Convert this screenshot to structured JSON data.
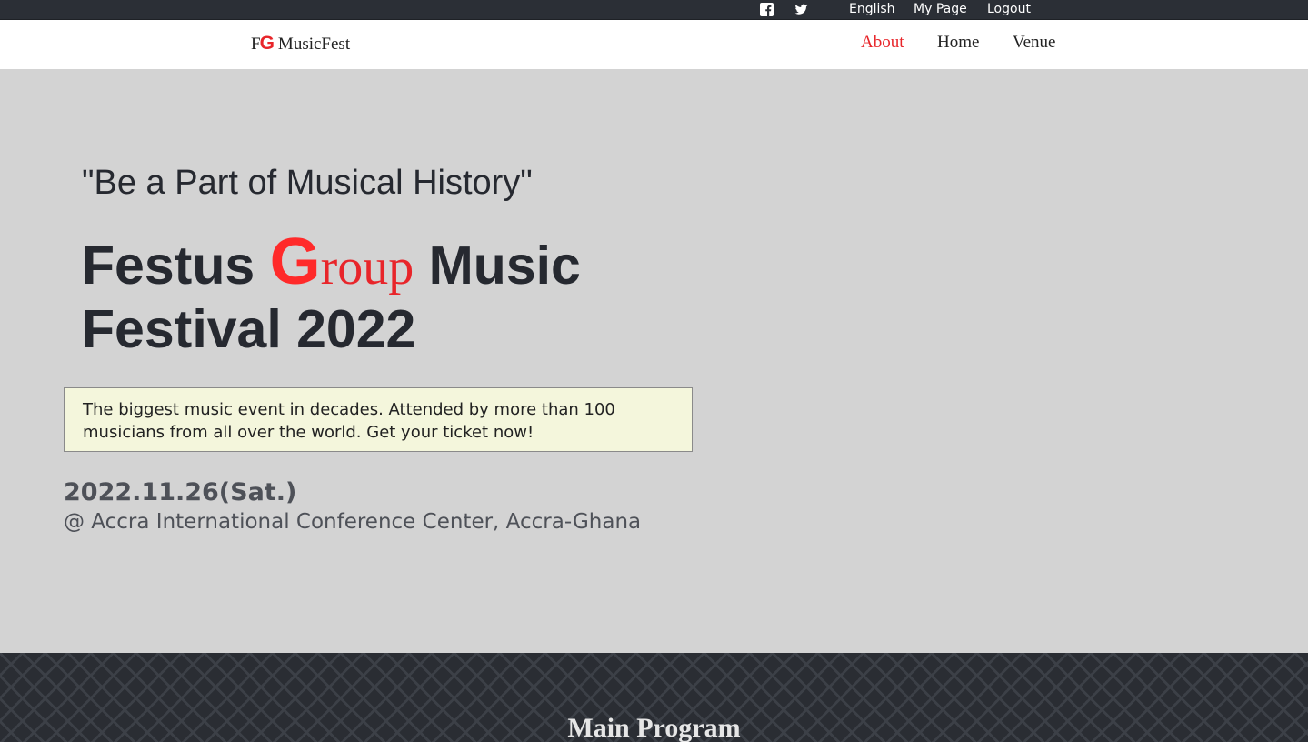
{
  "topbar": {
    "social_icons": [
      "facebook-icon",
      "twitter-icon"
    ],
    "language": "English",
    "my_page": "My Page",
    "logout": "Logout"
  },
  "header": {
    "logo_f": "F",
    "logo_g": "G",
    "logo_text": "MusicFest",
    "nav": [
      {
        "label": "About",
        "active": true
      },
      {
        "label": "Home",
        "active": false
      },
      {
        "label": "Venue",
        "active": false
      }
    ]
  },
  "hero": {
    "tagline": "\"Be a Part of Musical History\"",
    "title_word1": "Festus",
    "title_g": "G",
    "title_group_rest": "roup",
    "title_word3": "Music",
    "title_line2": "Festival 2022",
    "promo": "The biggest music event in decades. Attended by more than 100 musicians from all over the world. Get your ticket now!",
    "date": "2022.11.26(Sat.)",
    "venue": "@ Accra International Conference Center, Accra-Ghana"
  },
  "program": {
    "title": "Main Program"
  },
  "colors": {
    "accent_red": "#e8252a",
    "topbar_bg": "#2b2f36",
    "hero_bg": "#d3d3d3",
    "promo_bg": "#f4f6dc"
  }
}
